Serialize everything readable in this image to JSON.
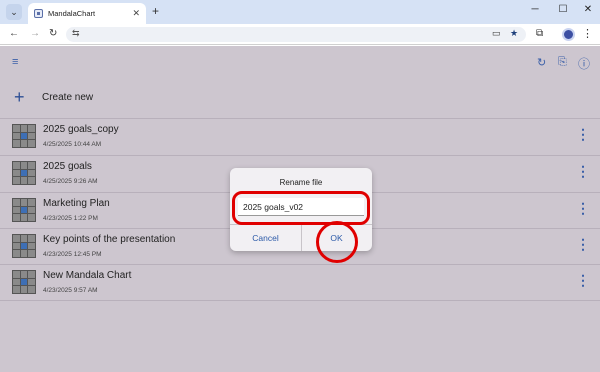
{
  "browser": {
    "tab_title": "MandalaChart",
    "close_glyph": "✕",
    "new_tab_glyph": "+",
    "win_minimize": "─",
    "win_maximize": "☐",
    "win_close": "✕",
    "nav_back": "←",
    "nav_forward": "→",
    "nav_reload": "↻",
    "site_info_glyph": "⇆",
    "more_glyph": "⋮",
    "icons": [
      "tab-search-icon",
      "cast-icon",
      "bookmark-star-icon",
      "extensions-icon",
      "profile-avatar"
    ]
  },
  "app_bar": {
    "sort_icon": "≡",
    "refresh_icon": "↻",
    "import_icon": "⎘",
    "info_icon": "ⓘ"
  },
  "create_new": {
    "plus": "+",
    "label": "Create new"
  },
  "files": [
    {
      "title": "2025 goals_copy",
      "date": "4/25/2025 10:44 AM"
    },
    {
      "title": "2025 goals",
      "date": "4/25/2025 9:26 AM"
    },
    {
      "title": "Marketing Plan",
      "date": "4/23/2025 1:22 PM"
    },
    {
      "title": "Key points of the presentation",
      "date": "4/23/2025 12:45 PM"
    },
    {
      "title": "New Mandala Chart",
      "date": "4/23/2025 9:57 AM"
    }
  ],
  "kebab_glyph": "⋮",
  "dialog": {
    "title": "Rename file",
    "input_value": "2025 goals_v02",
    "cancel_label": "Cancel",
    "ok_label": "OK"
  },
  "colors": {
    "accent": "#2c5aa8",
    "annotation": "#e00000",
    "scrim": "#cdc6cf"
  }
}
